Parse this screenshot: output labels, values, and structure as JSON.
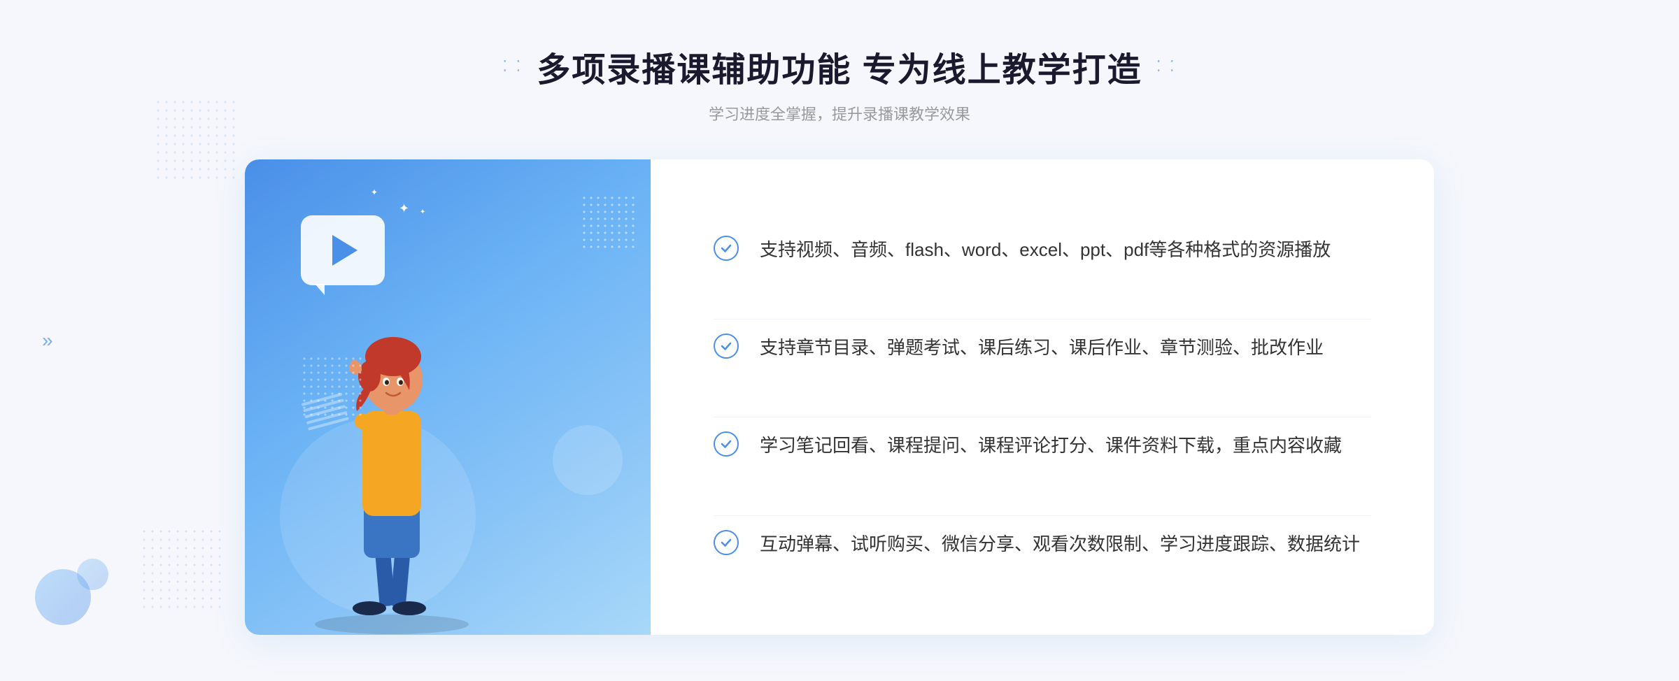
{
  "header": {
    "title": "多项录播课辅助功能 专为线上教学打造",
    "subtitle": "学习进度全掌握，提升录播课教学效果",
    "title_dots_left": "⁚ ⁚",
    "title_dots_right": "⁚ ⁚"
  },
  "features": [
    {
      "id": 1,
      "text": "支持视频、音频、flash、word、excel、ppt、pdf等各种格式的资源播放"
    },
    {
      "id": 2,
      "text": "支持章节目录、弹题考试、课后练习、课后作业、章节测验、批改作业"
    },
    {
      "id": 3,
      "text": "学习笔记回看、课程提问、课程评论打分、课件资料下载，重点内容收藏"
    },
    {
      "id": 4,
      "text": "互动弹幕、试听购买、微信分享、观看次数限制、学习进度跟踪、数据统计"
    }
  ],
  "colors": {
    "accent_blue": "#4a8fe8",
    "light_blue": "#6bb3f5",
    "text_dark": "#1a1a2e",
    "text_gray": "#999999",
    "text_body": "#333333"
  },
  "decorations": {
    "left_arrow": "»",
    "right_arrow": "«"
  }
}
